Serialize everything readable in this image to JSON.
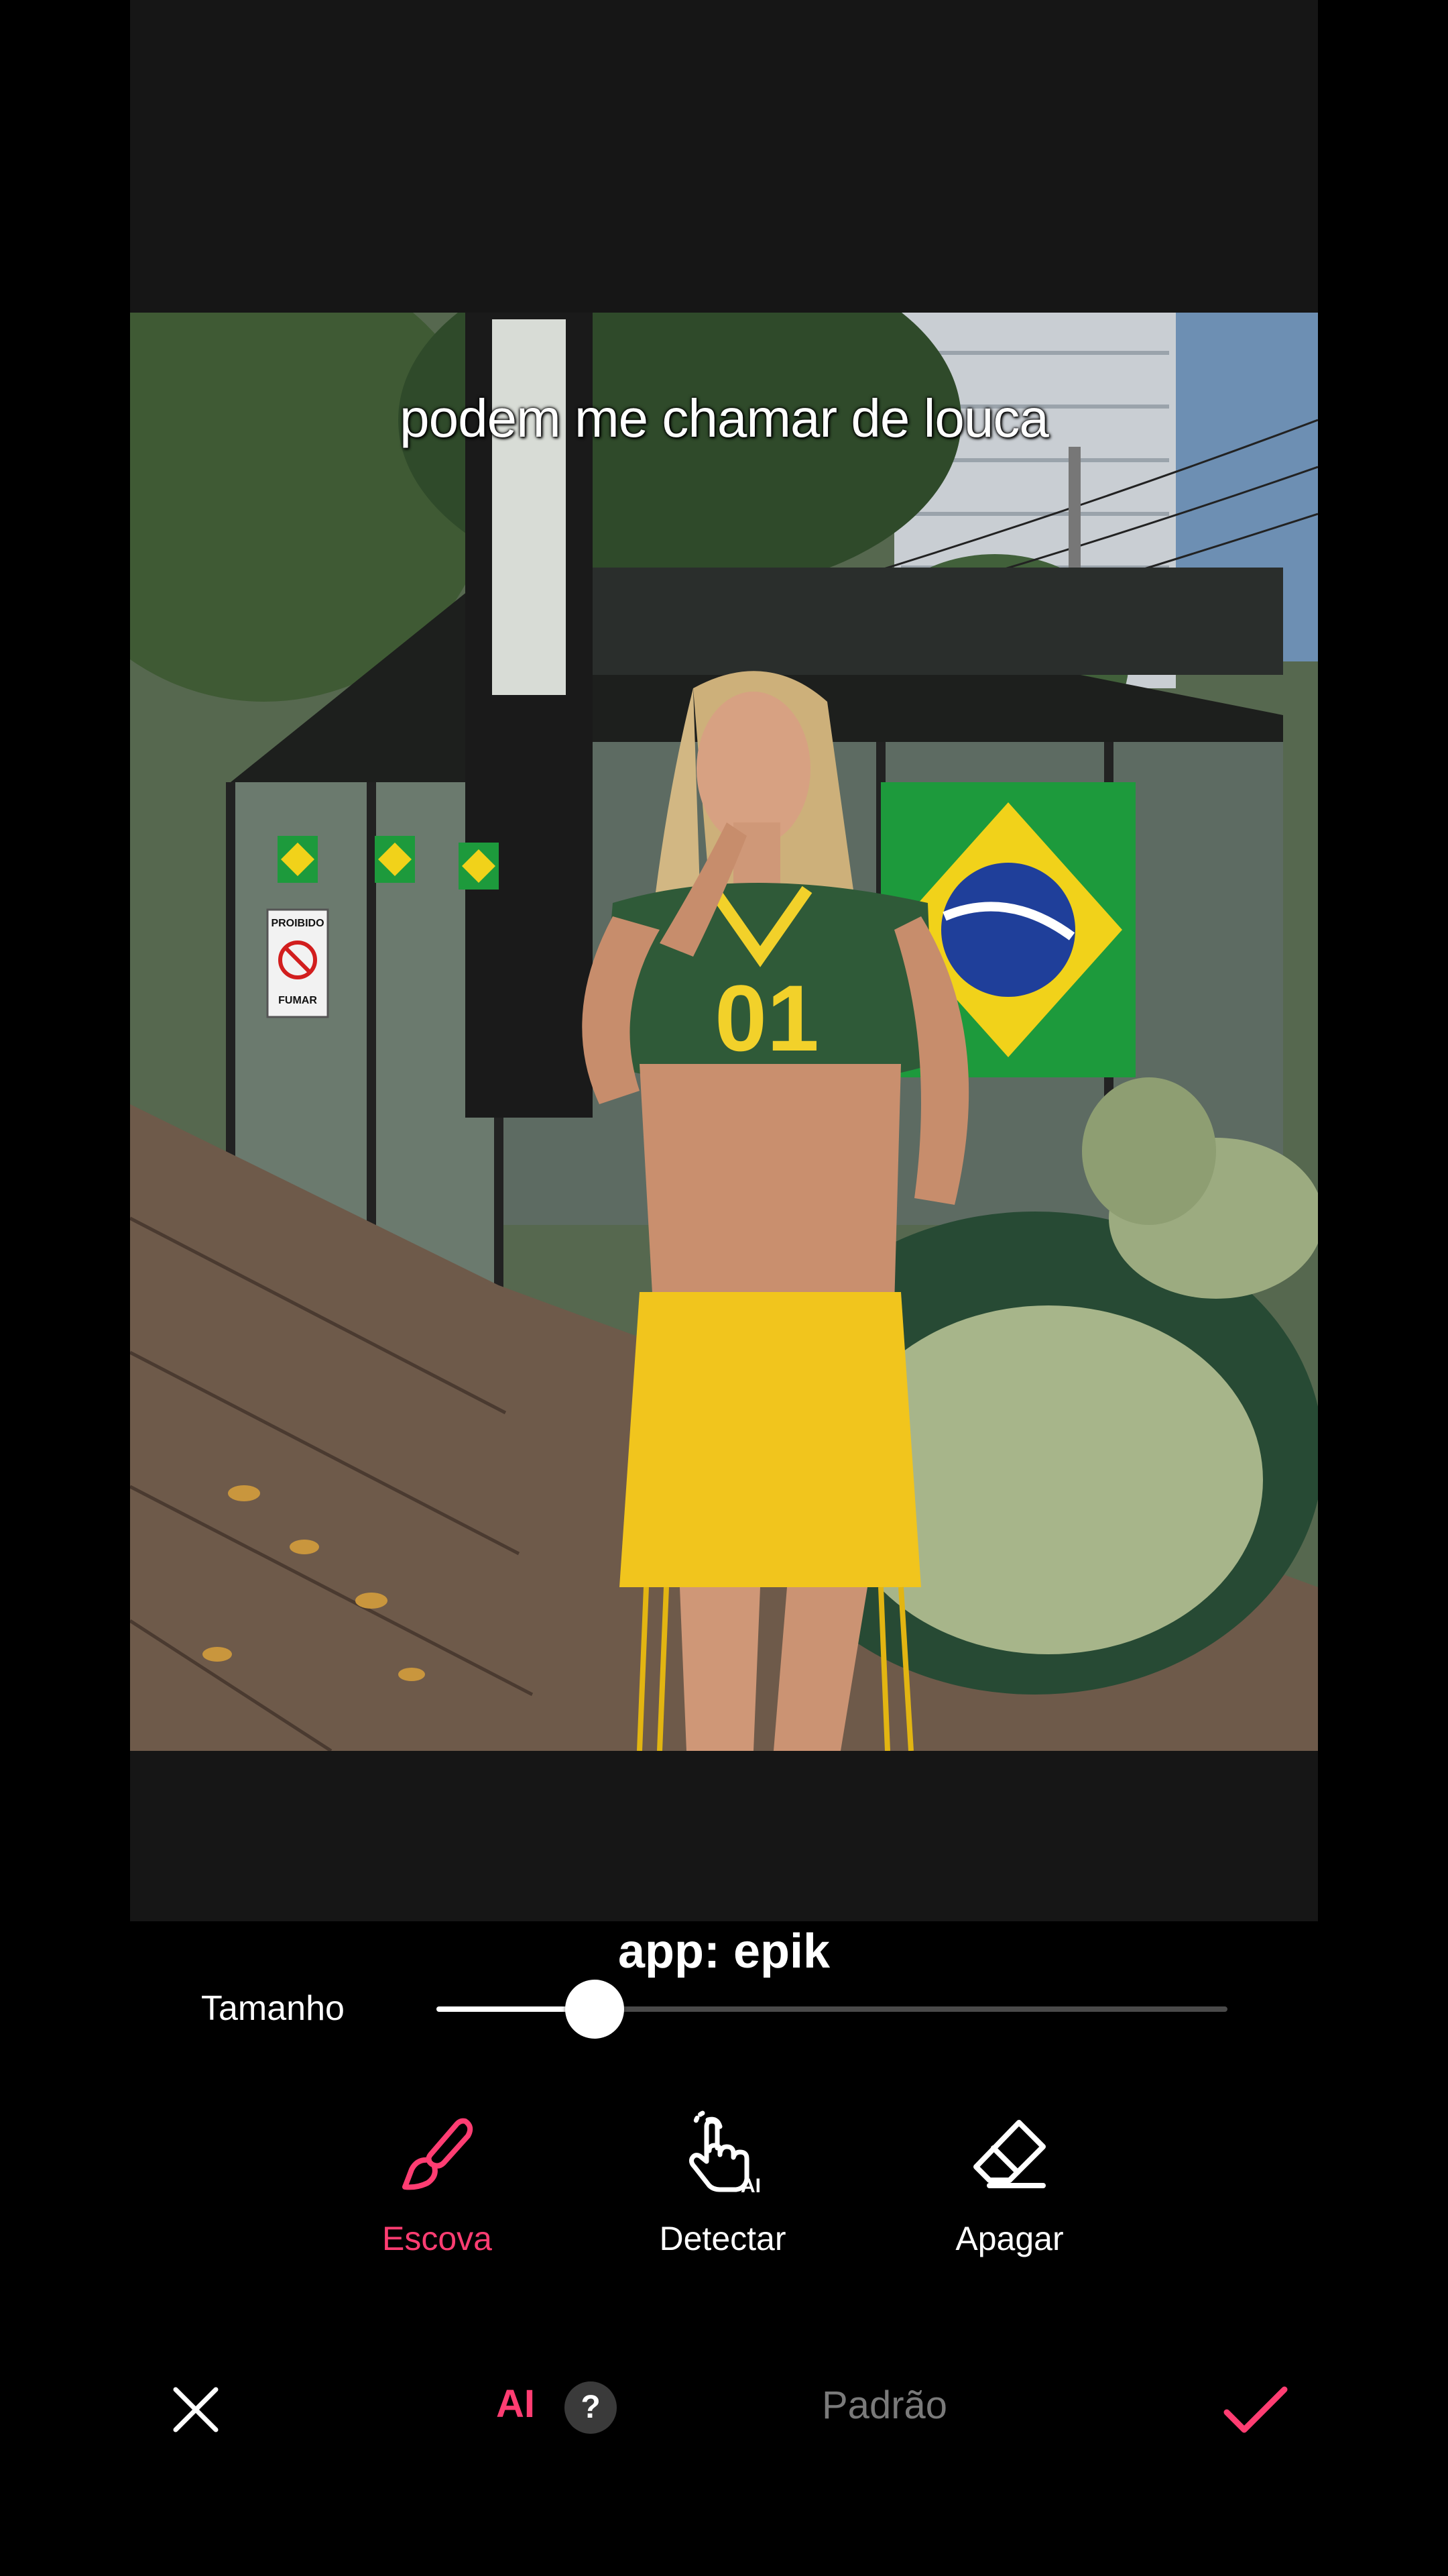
{
  "photo": {
    "caption": "podem me chamar de louca",
    "sign_line1": "PROIBIDO",
    "sign_line2": "FUMAR",
    "jersey_number": "01"
  },
  "watermark": "app: epik",
  "size_control": {
    "label": "Tamanho",
    "value_fraction": 0.2
  },
  "tools": [
    {
      "label": "Escova",
      "icon": "brush-icon",
      "active": true
    },
    {
      "label": "Detectar",
      "icon": "ai-tap-icon",
      "active": false,
      "icon_badge": "AI"
    },
    {
      "label": "Apagar",
      "icon": "eraser-icon",
      "active": false
    }
  ],
  "bottom_bar": {
    "close_icon": "close-icon",
    "mode_ai_label": "AI",
    "help_label": "?",
    "mode_default_label": "Padrão",
    "confirm_icon": "check-icon"
  },
  "colors": {
    "accent": "#ff3d72",
    "background": "#000000",
    "canvas_background": "#161616",
    "inactive_text": "#7a7a7a"
  }
}
